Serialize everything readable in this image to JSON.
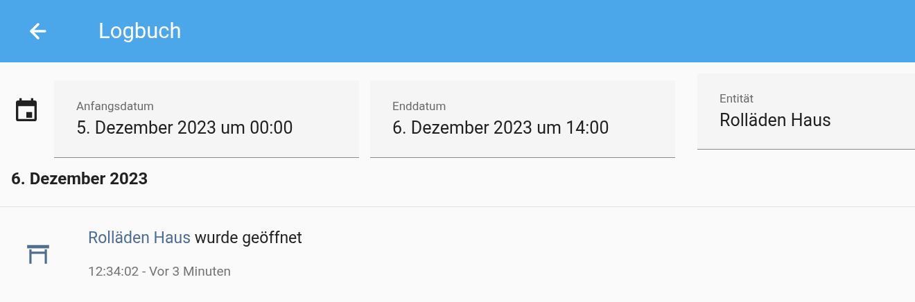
{
  "header": {
    "title": "Logbuch"
  },
  "filters": [
    {
      "label": "Anfangsdatum",
      "value": "5. Dezember 2023 um 00:00"
    },
    {
      "label": "Enddatum",
      "value": "6. Dezember 2023 um 14:00"
    },
    {
      "label": "Entität",
      "value": "Rolläden Haus"
    }
  ],
  "day": "6. Dezember 2023",
  "entries": [
    {
      "entity": "Rolläden Haus",
      "action": "wurde geöffnet",
      "time": "12:34:02 - Vor 3 Minuten"
    }
  ]
}
